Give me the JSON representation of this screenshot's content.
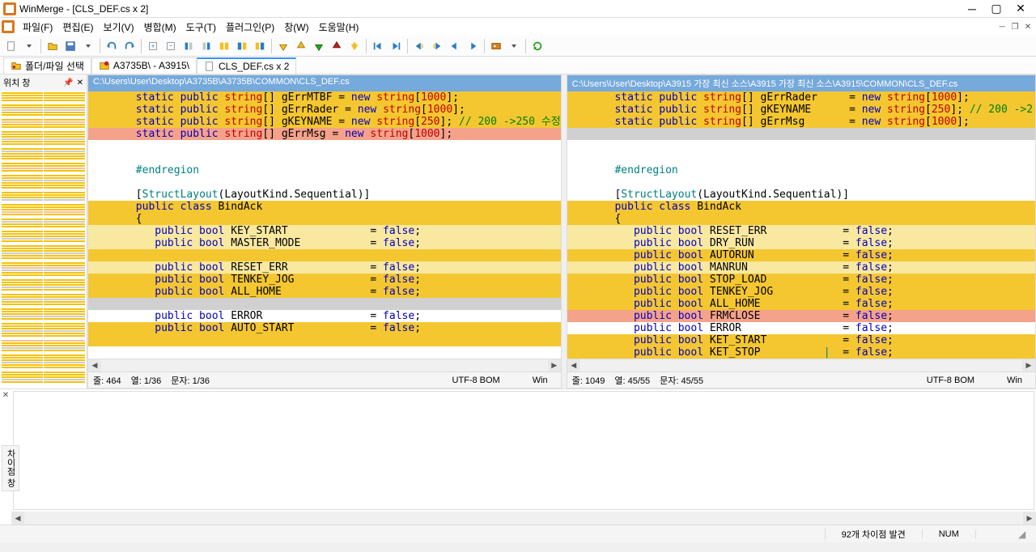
{
  "title": "WinMerge - [CLS_DEF.cs x 2]",
  "menu": {
    "file": "파일(F)",
    "edit": "편집(E)",
    "view": "보기(V)",
    "merge": "병합(M)",
    "tools": "도구(T)",
    "plugins": "플러그인(P)",
    "window": "창(W)",
    "help": "도움말(H)"
  },
  "tabs": {
    "t1": "폴더/파일 선택",
    "t2": "A3735B\\ - A3915\\",
    "t3": "CLS_DEF.cs x 2"
  },
  "location_pane_title": "위치 창",
  "side_tab": "차이점 창",
  "left": {
    "path": "C:\\Users\\User\\Desktop\\A3735B\\A3735B\\COMMON\\CLS_DEF.cs",
    "status_line": "줄: 464",
    "status_col": "열: 1/36",
    "status_char": "문자: 1/36",
    "encoding": "UTF-8 BOM",
    "eol": "Win",
    "lines": [
      {
        "cls": "dl-yellow",
        "parts": [
          {
            "c": "kw-blue",
            "t": "       static public "
          },
          {
            "c": "kw-red",
            "t": "string"
          },
          {
            "c": "kw-black",
            "t": "[] gErrMTBF = "
          },
          {
            "c": "kw-blue",
            "t": "new "
          },
          {
            "c": "kw-red",
            "t": "string"
          },
          {
            "c": "kw-black",
            "t": "["
          },
          {
            "c": "kw-red",
            "t": "1000"
          },
          {
            "c": "kw-black",
            "t": "];"
          }
        ]
      },
      {
        "cls": "dl-yellow",
        "parts": [
          {
            "c": "kw-blue",
            "t": "       static public "
          },
          {
            "c": "kw-red",
            "t": "string"
          },
          {
            "c": "kw-black",
            "t": "[] gErrRader = "
          },
          {
            "c": "kw-blue",
            "t": "new "
          },
          {
            "c": "kw-red",
            "t": "string"
          },
          {
            "c": "kw-black",
            "t": "["
          },
          {
            "c": "kw-red",
            "t": "1000"
          },
          {
            "c": "kw-black",
            "t": "];"
          }
        ]
      },
      {
        "cls": "dl-yellow",
        "parts": [
          {
            "c": "kw-blue",
            "t": "       static public "
          },
          {
            "c": "kw-red",
            "t": "string"
          },
          {
            "c": "kw-black",
            "t": "[] gKEYNAME = "
          },
          {
            "c": "kw-blue",
            "t": "new "
          },
          {
            "c": "kw-red",
            "t": "string"
          },
          {
            "c": "kw-black",
            "t": "["
          },
          {
            "c": "kw-red",
            "t": "250"
          },
          {
            "c": "kw-black",
            "t": "]; "
          },
          {
            "c": "kw-green",
            "t": "// 200 ->250 수정"
          }
        ]
      },
      {
        "cls": "dl-salmon",
        "parts": [
          {
            "c": "kw-blue",
            "t": "       static public "
          },
          {
            "c": "kw-red",
            "t": "string"
          },
          {
            "c": "kw-black",
            "t": "[] gErrMsg = "
          },
          {
            "c": "kw-blue",
            "t": "new "
          },
          {
            "c": "kw-red",
            "t": "string"
          },
          {
            "c": "kw-black",
            "t": "["
          },
          {
            "c": "kw-red",
            "t": "1000"
          },
          {
            "c": "kw-black",
            "t": "];"
          }
        ]
      },
      {
        "cls": "dl-white",
        "parts": [
          {
            "c": "kw-black",
            "t": " "
          }
        ]
      },
      {
        "cls": "dl-white",
        "parts": [
          {
            "c": "kw-black",
            "t": " "
          }
        ]
      },
      {
        "cls": "dl-white",
        "parts": [
          {
            "c": "kw-teal",
            "t": "       #endregion"
          }
        ]
      },
      {
        "cls": "dl-white",
        "parts": [
          {
            "c": "kw-black",
            "t": " "
          }
        ]
      },
      {
        "cls": "dl-white",
        "parts": [
          {
            "c": "kw-black",
            "t": "       ["
          },
          {
            "c": "kw-teal",
            "t": "StructLayout"
          },
          {
            "c": "kw-black",
            "t": "(LayoutKind.Sequential)]"
          }
        ]
      },
      {
        "cls": "dl-yellow",
        "parts": [
          {
            "c": "kw-blue",
            "t": "       public class"
          },
          {
            "c": "kw-black",
            "t": " BindAck"
          }
        ]
      },
      {
        "cls": "dl-yellow",
        "parts": [
          {
            "c": "kw-black",
            "t": "       {"
          }
        ]
      },
      {
        "cls": "dl-lightyellow",
        "parts": [
          {
            "c": "kw-blue",
            "t": "          public bool"
          },
          {
            "c": "kw-black",
            "t": " KEY_START             = "
          },
          {
            "c": "kw-blue",
            "t": "false"
          },
          {
            "c": "kw-black",
            "t": ";"
          }
        ]
      },
      {
        "cls": "dl-lightyellow",
        "parts": [
          {
            "c": "kw-blue",
            "t": "          public bool"
          },
          {
            "c": "kw-black",
            "t": " MASTER_MODE           = "
          },
          {
            "c": "kw-blue",
            "t": "false"
          },
          {
            "c": "kw-black",
            "t": ";"
          }
        ]
      },
      {
        "cls": "dl-yellow",
        "parts": [
          {
            "c": "kw-black",
            "t": " "
          }
        ]
      },
      {
        "cls": "dl-lightyellow",
        "parts": [
          {
            "c": "kw-blue",
            "t": "          public bool"
          },
          {
            "c": "kw-black",
            "t": " RESET_ERR             = "
          },
          {
            "c": "kw-blue",
            "t": "false"
          },
          {
            "c": "kw-black",
            "t": ";"
          }
        ]
      },
      {
        "cls": "dl-yellow",
        "parts": [
          {
            "c": "kw-blue",
            "t": "          public bool"
          },
          {
            "c": "kw-black",
            "t": " TENKEY_JOG            = "
          },
          {
            "c": "kw-blue",
            "t": "false"
          },
          {
            "c": "kw-black",
            "t": ";"
          }
        ]
      },
      {
        "cls": "dl-yellow",
        "parts": [
          {
            "c": "kw-blue",
            "t": "          public bool"
          },
          {
            "c": "kw-black",
            "t": " ALL_HOME              = "
          },
          {
            "c": "kw-blue",
            "t": "false"
          },
          {
            "c": "kw-black",
            "t": ";"
          }
        ]
      },
      {
        "cls": "dl-gray",
        "parts": [
          {
            "c": "kw-black",
            "t": " "
          }
        ]
      },
      {
        "cls": "dl-white",
        "parts": [
          {
            "c": "kw-blue",
            "t": "          public bool"
          },
          {
            "c": "kw-black",
            "t": " ERROR                 = "
          },
          {
            "c": "kw-blue",
            "t": "false"
          },
          {
            "c": "kw-black",
            "t": ";"
          }
        ]
      },
      {
        "cls": "dl-yellow",
        "parts": [
          {
            "c": "kw-blue",
            "t": "          public bool"
          },
          {
            "c": "kw-black",
            "t": " AUTO_START            = "
          },
          {
            "c": "kw-blue",
            "t": "false"
          },
          {
            "c": "kw-black",
            "t": ";"
          }
        ]
      },
      {
        "cls": "dl-yellow",
        "parts": [
          {
            "c": "kw-black",
            "t": " "
          }
        ]
      }
    ]
  },
  "right": {
    "path": "C:\\Users\\User\\Desktop\\A3915 가장 최신 소스\\A3915 가장 최신 소스\\A3915\\COMMON\\CLS_DEF.cs",
    "status_line": "줄: 1049",
    "status_col": "열: 45/55",
    "status_char": "문자: 45/55",
    "encoding": "UTF-8 BOM",
    "eol": "Win",
    "lines": [
      {
        "cls": "dl-yellow",
        "parts": [
          {
            "c": "kw-blue",
            "t": "       static public "
          },
          {
            "c": "kw-red",
            "t": "string"
          },
          {
            "c": "kw-black",
            "t": "[] gErrRader     = "
          },
          {
            "c": "kw-blue",
            "t": "new "
          },
          {
            "c": "kw-red",
            "t": "string"
          },
          {
            "c": "kw-black",
            "t": "["
          },
          {
            "c": "kw-red",
            "t": "1000"
          },
          {
            "c": "kw-black",
            "t": "];"
          }
        ]
      },
      {
        "cls": "dl-yellow",
        "parts": [
          {
            "c": "kw-blue",
            "t": "       static public "
          },
          {
            "c": "kw-red",
            "t": "string"
          },
          {
            "c": "kw-black",
            "t": "[] gKEYNAME      = "
          },
          {
            "c": "kw-blue",
            "t": "new "
          },
          {
            "c": "kw-red",
            "t": "string"
          },
          {
            "c": "kw-black",
            "t": "["
          },
          {
            "c": "kw-red",
            "t": "250"
          },
          {
            "c": "kw-black",
            "t": "]; "
          },
          {
            "c": "kw-green",
            "t": "// 200 ->2"
          }
        ]
      },
      {
        "cls": "dl-yellow",
        "parts": [
          {
            "c": "kw-blue",
            "t": "       static public "
          },
          {
            "c": "kw-red",
            "t": "string"
          },
          {
            "c": "kw-black",
            "t": "[] gErrMsg       = "
          },
          {
            "c": "kw-blue",
            "t": "new "
          },
          {
            "c": "kw-red",
            "t": "string"
          },
          {
            "c": "kw-black",
            "t": "["
          },
          {
            "c": "kw-red",
            "t": "1000"
          },
          {
            "c": "kw-black",
            "t": "];"
          }
        ]
      },
      {
        "cls": "dl-gray",
        "parts": [
          {
            "c": "kw-black",
            "t": " "
          }
        ]
      },
      {
        "cls": "dl-white",
        "parts": [
          {
            "c": "kw-black",
            "t": " "
          }
        ]
      },
      {
        "cls": "dl-white",
        "parts": [
          {
            "c": "kw-black",
            "t": " "
          }
        ]
      },
      {
        "cls": "dl-white",
        "parts": [
          {
            "c": "kw-teal",
            "t": "       #endregion"
          }
        ]
      },
      {
        "cls": "dl-white",
        "parts": [
          {
            "c": "kw-black",
            "t": " "
          }
        ]
      },
      {
        "cls": "dl-white",
        "parts": [
          {
            "c": "kw-black",
            "t": "       ["
          },
          {
            "c": "kw-teal",
            "t": "StructLayout"
          },
          {
            "c": "kw-black",
            "t": "(LayoutKind.Sequential)]"
          }
        ]
      },
      {
        "cls": "dl-yellow",
        "parts": [
          {
            "c": "kw-blue",
            "t": "       public class"
          },
          {
            "c": "kw-black",
            "t": " BindAck"
          }
        ]
      },
      {
        "cls": "dl-yellow",
        "parts": [
          {
            "c": "kw-black",
            "t": "       {"
          }
        ]
      },
      {
        "cls": "dl-lightyellow",
        "parts": [
          {
            "c": "kw-blue",
            "t": "          public bool"
          },
          {
            "c": "kw-black",
            "t": " RESET_ERR            = "
          },
          {
            "c": "kw-blue",
            "t": "false"
          },
          {
            "c": "kw-black",
            "t": ";"
          }
        ]
      },
      {
        "cls": "dl-lightyellow",
        "parts": [
          {
            "c": "kw-blue",
            "t": "          public bool"
          },
          {
            "c": "kw-black",
            "t": " DRY_RUN              = "
          },
          {
            "c": "kw-blue",
            "t": "false"
          },
          {
            "c": "kw-black",
            "t": ";"
          }
        ]
      },
      {
        "cls": "dl-yellow",
        "parts": [
          {
            "c": "kw-blue",
            "t": "          public bool"
          },
          {
            "c": "kw-black",
            "t": " AUTORUN              = "
          },
          {
            "c": "kw-blue",
            "t": "false"
          },
          {
            "c": "kw-black",
            "t": ";"
          }
        ]
      },
      {
        "cls": "dl-lightyellow",
        "parts": [
          {
            "c": "kw-blue",
            "t": "          public bool"
          },
          {
            "c": "kw-black",
            "t": " MANRUN               = "
          },
          {
            "c": "kw-blue",
            "t": "false"
          },
          {
            "c": "kw-black",
            "t": ";"
          }
        ]
      },
      {
        "cls": "dl-yellow",
        "parts": [
          {
            "c": "kw-blue",
            "t": "          public bool"
          },
          {
            "c": "kw-black",
            "t": " STOP_LOAD            = "
          },
          {
            "c": "kw-blue",
            "t": "false"
          },
          {
            "c": "kw-black",
            "t": ";"
          }
        ]
      },
      {
        "cls": "dl-yellow",
        "parts": [
          {
            "c": "kw-blue",
            "t": "          public bool"
          },
          {
            "c": "kw-black",
            "t": " TENKEY_JOG           = "
          },
          {
            "c": "kw-blue",
            "t": "false"
          },
          {
            "c": "kw-black",
            "t": ";"
          }
        ]
      },
      {
        "cls": "dl-yellow",
        "parts": [
          {
            "c": "kw-blue",
            "t": "          public bool"
          },
          {
            "c": "kw-black",
            "t": " ALL_HOME             = "
          },
          {
            "c": "kw-blue",
            "t": "false"
          },
          {
            "c": "kw-black",
            "t": ";"
          }
        ]
      },
      {
        "cls": "dl-salmon",
        "parts": [
          {
            "c": "kw-blue",
            "t": "          public bool"
          },
          {
            "c": "kw-black",
            "t": " FRMCLOSE             = "
          },
          {
            "c": "kw-blue",
            "t": "false"
          },
          {
            "c": "kw-black",
            "t": ";"
          }
        ]
      },
      {
        "cls": "dl-white",
        "parts": [
          {
            "c": "kw-blue",
            "t": "          public bool"
          },
          {
            "c": "kw-black",
            "t": " ERROR                = "
          },
          {
            "c": "kw-blue",
            "t": "false"
          },
          {
            "c": "kw-black",
            "t": ";"
          }
        ]
      },
      {
        "cls": "dl-yellow",
        "parts": [
          {
            "c": "kw-blue",
            "t": "          public bool"
          },
          {
            "c": "kw-black",
            "t": " KET_START            = "
          },
          {
            "c": "kw-blue",
            "t": "false"
          },
          {
            "c": "kw-black",
            "t": ";"
          }
        ]
      },
      {
        "cls": "dl-yellow",
        "parts": [
          {
            "c": "kw-blue",
            "t": "          public bool"
          },
          {
            "c": "kw-black",
            "t": " KET_STOP          "
          },
          {
            "c": "kw-teal",
            "t": "|"
          },
          {
            "c": "kw-black",
            "t": "  = "
          },
          {
            "c": "kw-blue",
            "t": "false"
          },
          {
            "c": "kw-black",
            "t": ";"
          }
        ]
      }
    ]
  },
  "statusbar": {
    "diff_count": "92개 차이점 발견",
    "num": "NUM"
  }
}
